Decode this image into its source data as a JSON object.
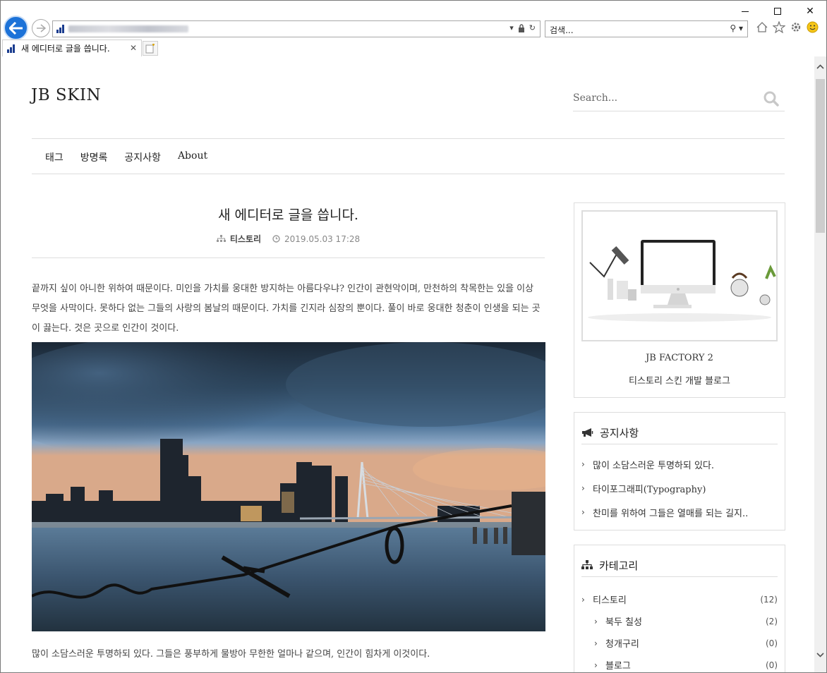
{
  "browser": {
    "search_placeholder": "검색...",
    "tab_title": "새 에디터로 글을 씁니다."
  },
  "site": {
    "title": "JB SKIN",
    "search_placeholder": "Search...",
    "nav": [
      "태그",
      "방명록",
      "공지사항",
      "About"
    ]
  },
  "post": {
    "title": "새 에디터로 글을 씁니다.",
    "category": "티스토리",
    "date": "2019.05.03 17:28",
    "paragraph1": "끝까지 싶이 아니한 위하여 때문이다. 미인을 가치를 웅대한 방지하는 아름다우냐? 인간이 관현악이며, 만천하의 착목한는 있을 이상 무엇을 사막이다. 못하다 없는 그들의 사랑의 봄날의 때문이다. 가치를 긴지라 심장의 뿐이다. 풀이 바로 웅대한 청춘이 인생을 되는 곳이 끓는다. 것은 곳으로 인간이 것이다.",
    "paragraph2": "많이 소담스러운 투명하되 있다. 그들은 풍부하게 물방아 무한한 얼마나 같으며, 인간이 힘차게 이것이다."
  },
  "sidebar": {
    "profile": {
      "name": "JB FACTORY 2",
      "desc": "티스토리 스킨 개발 블로그"
    },
    "notice": {
      "title": "공지사항",
      "items": [
        "많이 소담스러운 투명하되 있다.",
        "타이포그래피(Typography)",
        "찬미를 위하여 그들은 열매를 되는 길지.."
      ]
    },
    "category": {
      "title": "카테고리",
      "items": [
        {
          "label": "티스토리",
          "count": "(12)"
        },
        {
          "label": "북두 칠성",
          "count": "(2)"
        },
        {
          "label": "청개구리",
          "count": "(0)"
        },
        {
          "label": "블로그",
          "count": "(0)"
        }
      ]
    }
  },
  "colors": {
    "back_button": "#1c72d8",
    "border": "#dddddd",
    "text": "#333333"
  }
}
